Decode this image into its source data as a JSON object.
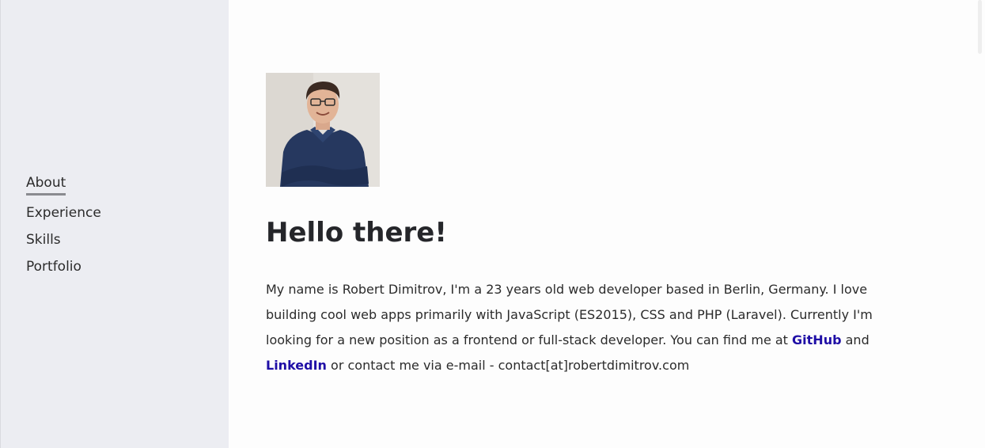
{
  "nav": {
    "items": [
      {
        "label": "About"
      },
      {
        "label": "Experience"
      },
      {
        "label": "Skills"
      },
      {
        "label": "Portfolio"
      }
    ]
  },
  "main": {
    "heading": "Hello there!",
    "bio_part1": "My name is Robert Dimitrov, I'm a 23 years old web developer based in Berlin, Germany. I love building cool web apps primarily with JavaScript (ES2015), CSS and PHP (Laravel). Currently I'm looking for a new position as a frontend or full-stack developer. You can find me at ",
    "github_label": "GitHub",
    "bio_part2": " and ",
    "linkedin_label": "LinkedIn",
    "bio_part3": " or contact me via e-mail - contact[at]robertdimitrov.com"
  },
  "colors": {
    "sidebar_bg": "#ecedf2",
    "link": "#1f0ea6",
    "text": "#2b2b2b"
  }
}
